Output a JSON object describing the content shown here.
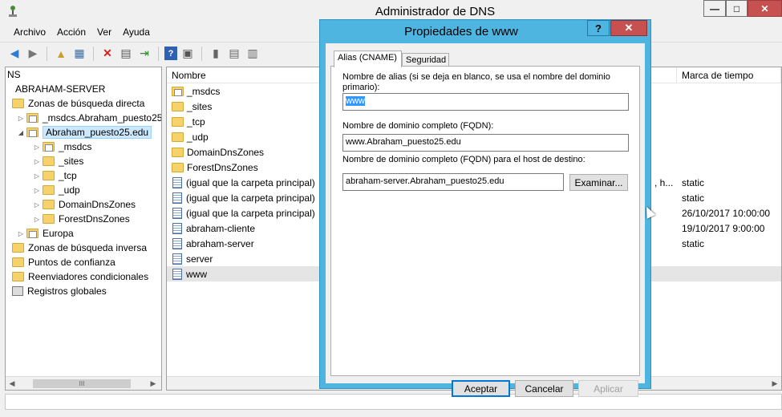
{
  "window": {
    "title": "Administrador de DNS",
    "minimize": "—",
    "maximize": "□",
    "close": "✕"
  },
  "menu": [
    "Archivo",
    "Acción",
    "Ver",
    "Ayuda"
  ],
  "tree": {
    "root_truncated": "NS",
    "server": "ABRAHAM-SERVER",
    "items": [
      "Zonas de búsqueda directa",
      "_msdcs.Abraham_puesto25",
      "Abraham_puesto25.edu",
      "_msdcs",
      "_sites",
      "_tcp",
      "_udp",
      "DomainDnsZones",
      "ForestDnsZones",
      "Europa",
      "Zonas de búsqueda inversa",
      "Puntos de confianza",
      "Reenviadores condicionales",
      "Registros globales"
    ]
  },
  "list": {
    "col_name": "Nombre",
    "col_timestamp": "Marca de tiempo",
    "rows": [
      {
        "name": "_msdcs",
        "trunc": "",
        "ts": ""
      },
      {
        "name": "_sites",
        "trunc": "",
        "ts": ""
      },
      {
        "name": "_tcp",
        "trunc": "",
        "ts": ""
      },
      {
        "name": "_udp",
        "trunc": "",
        "ts": ""
      },
      {
        "name": "DomainDnsZones",
        "trunc": "",
        "ts": ""
      },
      {
        "name": "ForestDnsZones",
        "trunc": "",
        "ts": ""
      },
      {
        "name": "(igual que la carpeta principal)",
        "trunc": ", h...",
        "ts": "static"
      },
      {
        "name": "(igual que la carpeta principal)",
        "trunc": "",
        "ts": "static"
      },
      {
        "name": "(igual que la carpeta principal)",
        "trunc": "",
        "ts": "26/10/2017 10:00:00"
      },
      {
        "name": "abraham-cliente",
        "trunc": "",
        "ts": "19/10/2017 9:00:00"
      },
      {
        "name": "abraham-server",
        "trunc": "",
        "ts": "static"
      },
      {
        "name": "server",
        "trunc": "",
        "ts": ""
      },
      {
        "name": "www",
        "trunc": "",
        "ts": ""
      }
    ]
  },
  "dialog": {
    "title": "Propiedades de www",
    "help": "?",
    "close": "✕",
    "tabs": [
      "Alias (CNAME)",
      "Seguridad"
    ],
    "alias_label": "Nombre de alias (si se deja en blanco, se usa el nombre del dominio primario):",
    "alias_value": "www",
    "fqdn_label": "Nombre de dominio completo (FQDN):",
    "fqdn_value": "www.Abraham_puesto25.edu",
    "target_label": "Nombre de dominio completo (FQDN) para el host de destino:",
    "target_value": "abraham-server.Abraham_puesto25.edu",
    "browse": "Examinar...",
    "ok": "Aceptar",
    "cancel": "Cancelar",
    "apply": "Aplicar"
  }
}
